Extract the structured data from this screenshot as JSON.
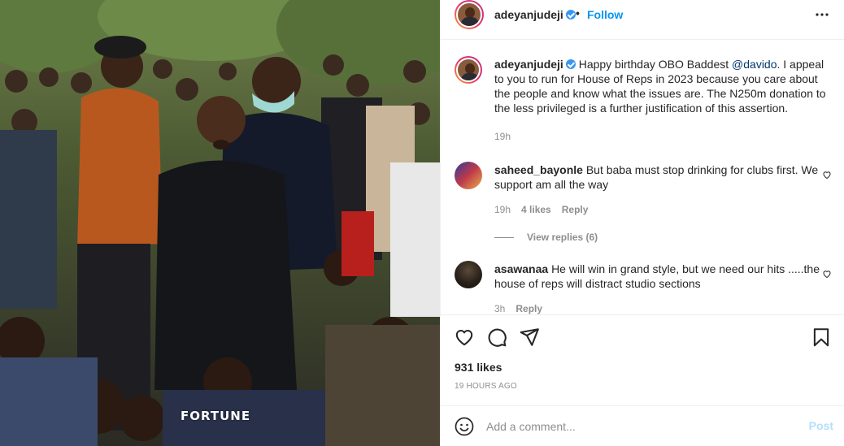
{
  "photo": {
    "watermark": "FORTUNE",
    "alt_icon": "crowd-photo"
  },
  "header": {
    "username": "adeyanjudeji",
    "separator": "•",
    "follow_label": "Follow",
    "more_icon": "more-horizontal-icon"
  },
  "caption": {
    "username": "adeyanjudeji",
    "text_before": "Happy birthday OBO Baddest ",
    "mention": "@davido",
    "text_after": ". I appeal to you to run for House of Reps in 2023 because you care about the people and know what the issues are. The N250m donation to the less privileged is a further justification of this assertion.",
    "time": "19h"
  },
  "comments": [
    {
      "username": "saheed_bayonle",
      "text": "But baba must stop drinking for clubs first. We support am all the way",
      "time": "19h",
      "likes": "4 likes",
      "reply_label": "Reply",
      "view_replies": "View replies (6)"
    },
    {
      "username": "asawanaa",
      "text": "He will win in grand style, but we need our hits .....the house of reps will distract studio sections",
      "time": "3h",
      "reply_label": "Reply"
    }
  ],
  "actions": {
    "likes": "931 likes",
    "time_ago": "19 HOURS AGO"
  },
  "add_comment": {
    "placeholder": "Add a comment...",
    "post_label": "Post"
  },
  "colors": {
    "accent": "#0095f6",
    "mention": "#00376b",
    "muted": "#8e8e8e",
    "post_disabled": "#b2dffc",
    "border": "#efefef"
  }
}
